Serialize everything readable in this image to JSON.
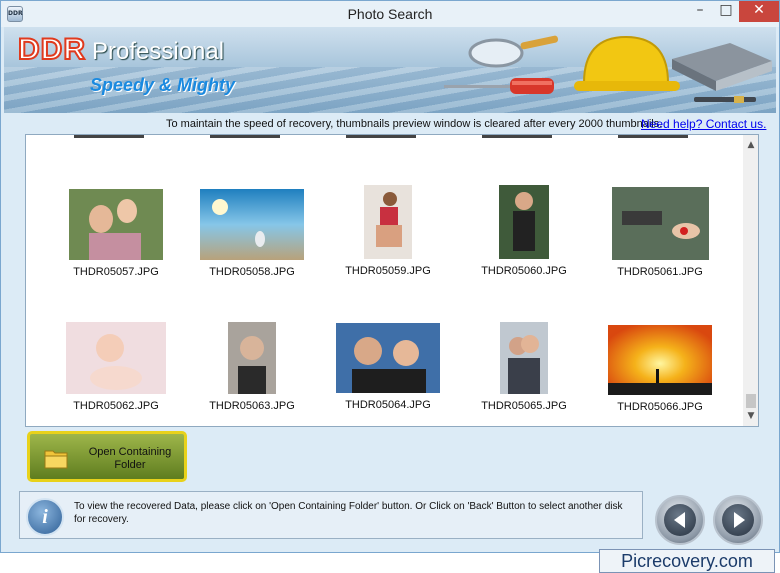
{
  "window": {
    "title": "Photo Search",
    "icon_text": "DDR"
  },
  "banner": {
    "brand": "DDR",
    "product": "Professional",
    "tagline": "Speedy & Mighty"
  },
  "info": {
    "message": "To maintain the speed of recovery, thumbnails preview window is cleared after every 2000 thumbnails.",
    "help_link": "Need help? Contact us."
  },
  "thumbnails": [
    {
      "file": "THDR05057.JPG"
    },
    {
      "file": "THDR05058.JPG"
    },
    {
      "file": "THDR05059.JPG"
    },
    {
      "file": "THDR05060.JPG"
    },
    {
      "file": "THDR05061.JPG"
    },
    {
      "file": "THDR05062.JPG"
    },
    {
      "file": "THDR05063.JPG"
    },
    {
      "file": "THDR05064.JPG"
    },
    {
      "file": "THDR05065.JPG"
    },
    {
      "file": "THDR05066.JPG"
    }
  ],
  "actions": {
    "open_folder": "Open Containing Folder"
  },
  "status": {
    "message": "To view the recovered Data, please click on 'Open Containing Folder' button. Or Click on 'Back' Button to select another disk for recovery."
  },
  "watermark": "Picrecovery.com",
  "colors": {
    "accent_red": "#e03a1e",
    "tagline_blue": "#1a8ae0",
    "button_frame": "#e8d21b",
    "link": "#0000ee"
  },
  "icons": [
    "magnifier-icon",
    "screwdriver-icon",
    "hard-hat-icon",
    "book-icon",
    "pen-icon",
    "folder-icon",
    "info-icon",
    "back-arrow-icon",
    "next-arrow-icon"
  ]
}
